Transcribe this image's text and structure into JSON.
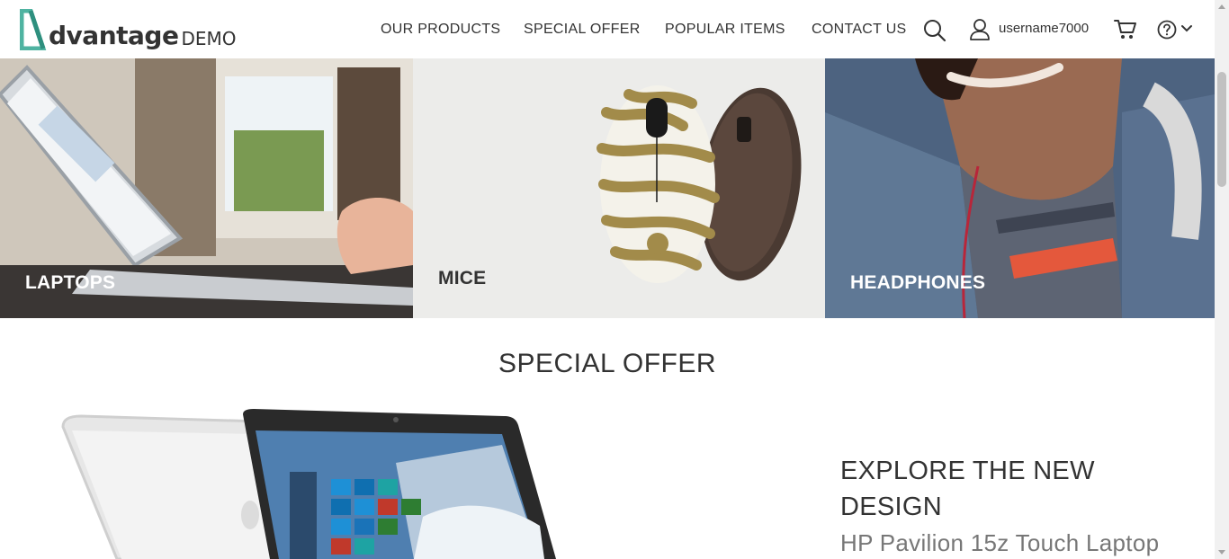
{
  "header": {
    "logo_text": "dvantage",
    "logo_demo": "DEMO",
    "nav": [
      "OUR PRODUCTS",
      "SPECIAL OFFER",
      "POPULAR ITEMS",
      "CONTACT US"
    ],
    "username": "username7000",
    "icons": [
      "search-icon",
      "user-icon",
      "cart-icon",
      "help-icon",
      "chevron-down-icon"
    ]
  },
  "categories": [
    {
      "label": "LAPTOPS",
      "label_color": "#ffffff"
    },
    {
      "label": "MICE",
      "label_color": "#333333"
    },
    {
      "label": "HEADPHONES",
      "label_color": "#ffffff"
    }
  ],
  "special_offer": {
    "section_title": "SPECIAL OFFER",
    "title": "EXPLORE THE NEW DESIGN",
    "subtitle": "HP Pavilion 15z Touch Laptop"
  },
  "colors": {
    "brand": "#5cc3b0",
    "text": "#333333"
  }
}
